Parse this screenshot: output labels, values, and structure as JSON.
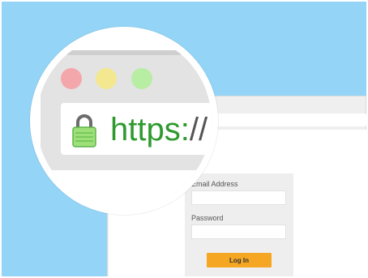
{
  "address_bar": {
    "protocol": "https:",
    "slashes": "//"
  },
  "login_form": {
    "email_label": "Email Address",
    "password_label": "Password",
    "login_button": "Log In"
  },
  "icons": {
    "lock": "lock-icon"
  },
  "colors": {
    "background": "#94d5f7",
    "url_green": "#2e9a2e",
    "button": "#f5a623",
    "close_dot": "#f4a7ab",
    "minimize_dot": "#f3e88f",
    "maximize_dot": "#b8eda4"
  }
}
